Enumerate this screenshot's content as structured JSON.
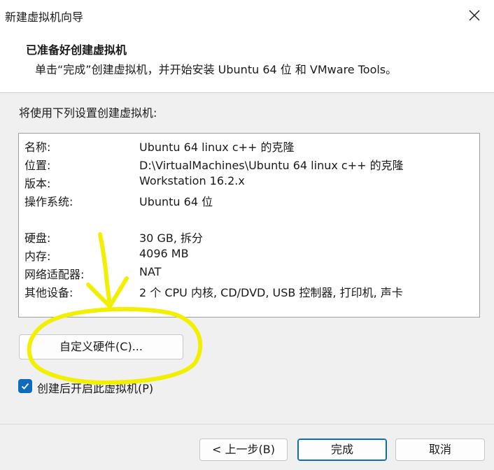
{
  "window": {
    "title": "新建虚拟机向导",
    "close_icon": "close-icon"
  },
  "header": {
    "title": "已准备好创建虚拟机",
    "subtitle": "单击“完成”创建虚拟机，并开始安装 Ubuntu 64 位 和 VMware Tools。"
  },
  "intro": "将使用下列设置创建虚拟机:",
  "settings": [
    {
      "label": "名称:",
      "value": "Ubuntu 64 linux c++ 的克隆"
    },
    {
      "label": "位置:",
      "value": "D:\\VirtualMachines\\Ubuntu 64 linux c++ 的克隆"
    },
    {
      "label": "版本:",
      "value": "Workstation 16.2.x"
    },
    {
      "label": "操作系统:",
      "value": "Ubuntu 64 位"
    },
    {
      "label": "硬盘:",
      "value": "30 GB, 拆分"
    },
    {
      "label": "内存:",
      "value": "4096 MB"
    },
    {
      "label": "网络适配器:",
      "value": "NAT"
    },
    {
      "label": "其他设备:",
      "value": "2 个 CPU 内核, CD/DVD, USB 控制器, 打印机, 声卡"
    }
  ],
  "customize_button": "自定义硬件(C)...",
  "power_on_checkbox": {
    "label": "创建后开启此虚拟机(P)",
    "checked": true
  },
  "buttons": {
    "back": "< 上一步(B)",
    "finish": "完成",
    "cancel": "取消"
  },
  "colors": {
    "accent": "#0f6cbd",
    "annotation": "#f2f000"
  }
}
